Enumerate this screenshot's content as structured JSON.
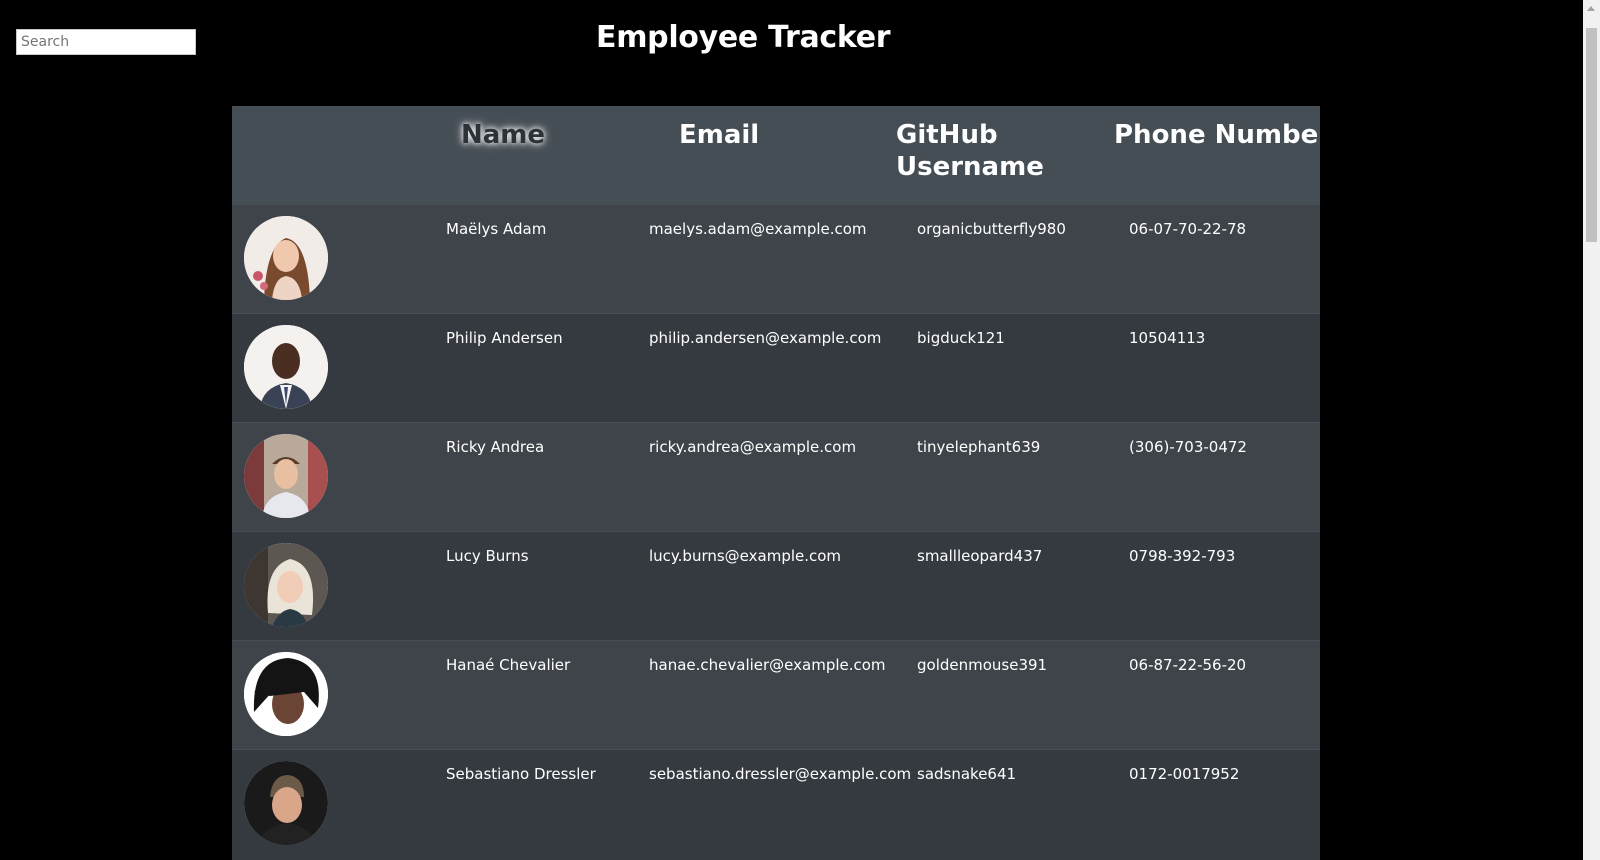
{
  "search": {
    "placeholder": "Search",
    "value": ""
  },
  "header": {
    "title": "Employee Tracker"
  },
  "table": {
    "columns": {
      "image": "",
      "name": "Name",
      "email": "Email",
      "github": "GitHub Username",
      "phone": "Phone Number"
    },
    "rows": [
      {
        "name": "Maëlys Adam",
        "email": "maelys.adam@example.com",
        "github": "organicbutterfly980",
        "phone": "06-07-70-22-78",
        "avatar": "person-photo-icon"
      },
      {
        "name": "Philip Andersen",
        "email": "philip.andersen@example.com",
        "github": "bigduck121",
        "phone": "10504113",
        "avatar": "person-photo-icon"
      },
      {
        "name": "Ricky Andrea",
        "email": "ricky.andrea@example.com",
        "github": "tinyelephant639",
        "phone": "(306)-703-0472",
        "avatar": "person-photo-icon"
      },
      {
        "name": "Lucy Burns",
        "email": "lucy.burns@example.com",
        "github": "smallleopard437",
        "phone": "0798-392-793",
        "avatar": "person-photo-icon"
      },
      {
        "name": "Hanaé Chevalier",
        "email": "hanae.chevalier@example.com",
        "github": "goldenmouse391",
        "phone": "06-87-22-56-20",
        "avatar": "person-photo-icon"
      },
      {
        "name": "Sebastiano Dressler",
        "email": "sebastiano.dressler@example.com",
        "github": "sadsnake641",
        "phone": "0172-0017952",
        "avatar": "person-photo-icon"
      }
    ]
  },
  "colors": {
    "page_background": "#000000",
    "table_header": "#454d55",
    "row_light": "#3e444a",
    "row_dark": "#343a40",
    "text": "#ffffff"
  }
}
